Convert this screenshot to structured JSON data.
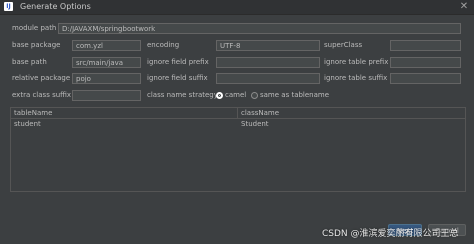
{
  "window": {
    "title": "Generate Options"
  },
  "form": {
    "module_path_label": "module path",
    "module_path_value": "D:/JAVAXM/springbootwork",
    "base_package_label": "base package",
    "base_package_value": "com.yzl",
    "encoding_label": "encoding",
    "encoding_value": "UTF-8",
    "superclass_label": "superClass",
    "superclass_value": "",
    "base_path_label": "base path",
    "base_path_value": "src/main/java",
    "ignore_field_prefix_label": "ignore field prefix",
    "ignore_field_prefix_value": "",
    "ignore_table_prefix_label": "ignore table prefix",
    "ignore_table_prefix_value": "",
    "relative_package_label": "relative package",
    "relative_package_value": "pojo",
    "ignore_field_suffix_label": "ignore field suffix",
    "ignore_field_suffix_value": "",
    "ignore_table_suffix_label": "ignore table suffix",
    "ignore_table_suffix_value": "",
    "extra_class_suffix_label": "extra class suffix",
    "extra_class_suffix_value": "",
    "class_name_strategy_label": "class name strategy",
    "strategy_options": [
      "camel",
      "same as tablename"
    ],
    "strategy_selected": "camel"
  },
  "table": {
    "columns": [
      "tableName",
      "className"
    ],
    "rows": [
      [
        "student",
        "Student"
      ]
    ]
  },
  "buttons": {
    "next": "Next",
    "cancel": "Cancel"
  },
  "watermark": "CSDN @淮滨爱奕丽有限公司王总"
}
